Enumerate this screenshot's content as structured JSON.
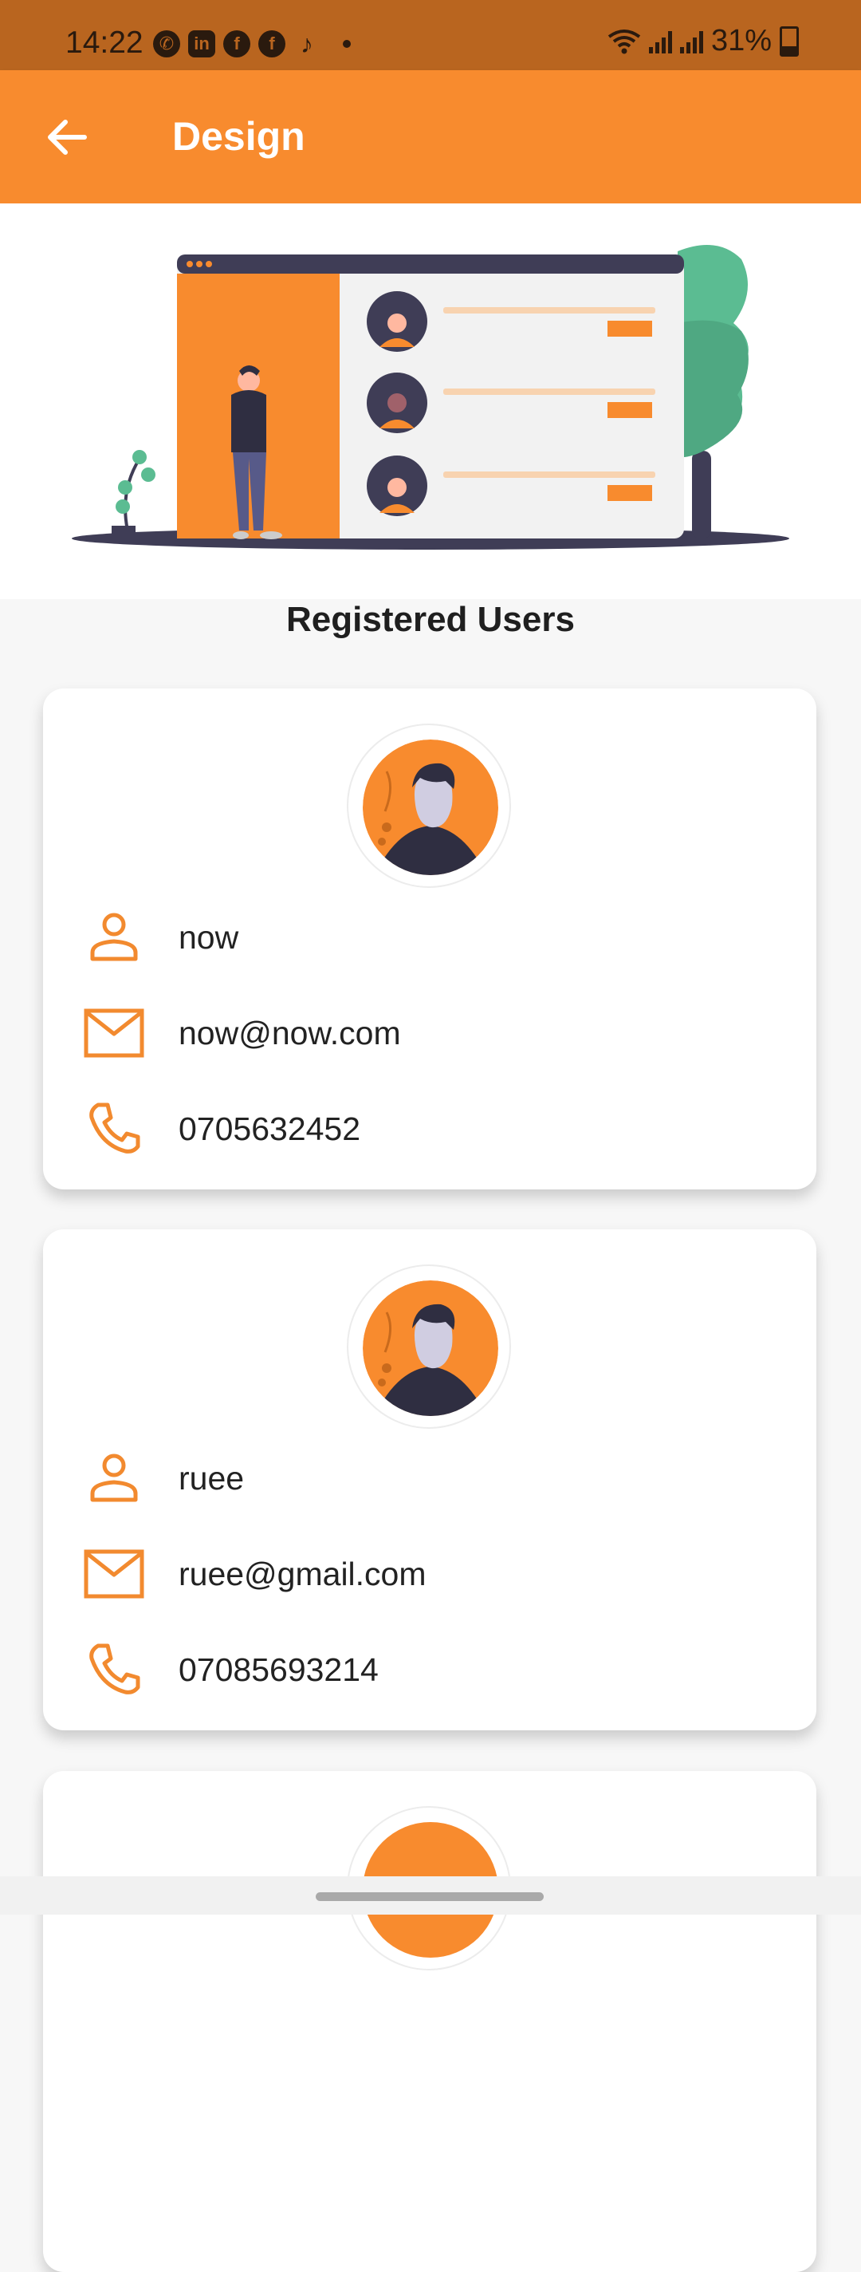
{
  "status_bar": {
    "time": "14:22",
    "battery": "31%",
    "icons": [
      "whatsapp-icon",
      "linkedin-icon",
      "facebook-icon",
      "facebook-icon",
      "tiktok-icon",
      "dot-icon",
      "wifi-icon",
      "signal-icon",
      "signal-icon",
      "battery-icon"
    ]
  },
  "app_bar": {
    "title": "Design",
    "back_icon": "arrow-left-icon"
  },
  "section": {
    "title": "Registered Users"
  },
  "users": [
    {
      "name": "now",
      "email": "now@now.com",
      "phone": "0705632452"
    },
    {
      "name": "ruee",
      "email": "ruee@gmail.com",
      "phone": "07085693214"
    }
  ],
  "colors": {
    "accent": "#f88b2e",
    "status_bar": "#b9651f",
    "dark": "#3f3d56",
    "green": "#5bbc92"
  }
}
